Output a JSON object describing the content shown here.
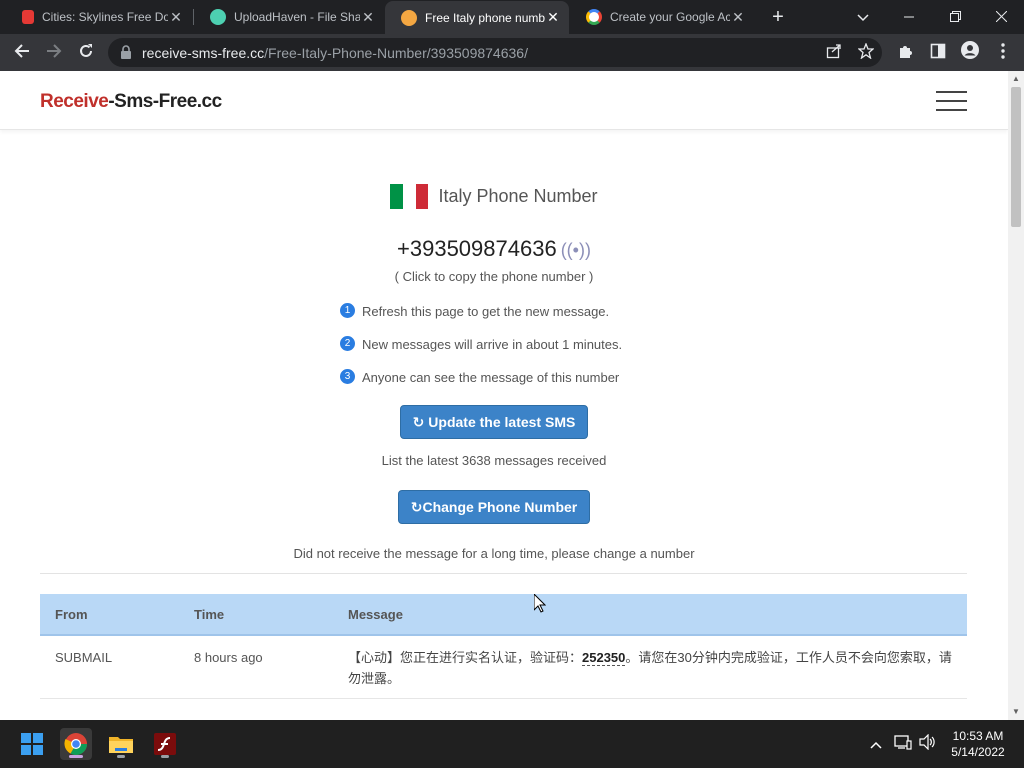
{
  "browser": {
    "tabs": [
      {
        "title": "Cities: Skylines Free Do",
        "favicon_color": "#e53935",
        "active": false
      },
      {
        "title": "UploadHaven - File Sha",
        "favicon_color": "#4dd0b1",
        "active": false
      },
      {
        "title": "Free Italy phone numbe",
        "favicon_color": "#f4a742",
        "active": true
      },
      {
        "title": "Create your Google Ac",
        "favicon_color": "#4285f4",
        "active": false
      }
    ],
    "close_glyph": "✕",
    "new_tab_glyph": "+",
    "url": {
      "host": "receive-sms-free.cc",
      "path": "/Free-Italy-Phone-Number/393509874636/"
    }
  },
  "site": {
    "logo_part1": "Receive",
    "logo_part2": "-Sms-Free.cc",
    "country_title": "Italy Phone Number",
    "flag_colors": [
      "#009246",
      "#ffffff",
      "#ce2b37"
    ],
    "phone_number": "+393509874636",
    "signal_glyph": "((•))",
    "copy_hint": "( Click to copy the phone number )",
    "tips": [
      {
        "num": "1",
        "text": "Refresh this page to get the new message."
      },
      {
        "num": "2",
        "text": "New messages will arrive in about 1 minutes."
      },
      {
        "num": "3",
        "text": "Anyone can see the message of this number"
      }
    ],
    "update_button": "↻ Update the latest SMS",
    "messages_count_text": "List the latest 3638 messages received",
    "change_button": "↻Change Phone Number",
    "change_hint": "Did not receive the message for a long time, please change a number",
    "table": {
      "headers": [
        "From",
        "Time",
        "Message"
      ],
      "rows": [
        {
          "from": "SUBMAIL",
          "time": "8 hours ago",
          "msg_before": "【心动】您正在进行实名认证，验证码：",
          "code": "252350",
          "msg_after": "。请您在30分钟内完成验证，工作人员不会向您索取，请勿泄露。"
        }
      ]
    }
  },
  "taskbar": {
    "time": "10:53 AM",
    "date": "5/14/2022",
    "apps": [
      "start",
      "chrome",
      "file-explorer",
      "flash"
    ]
  }
}
